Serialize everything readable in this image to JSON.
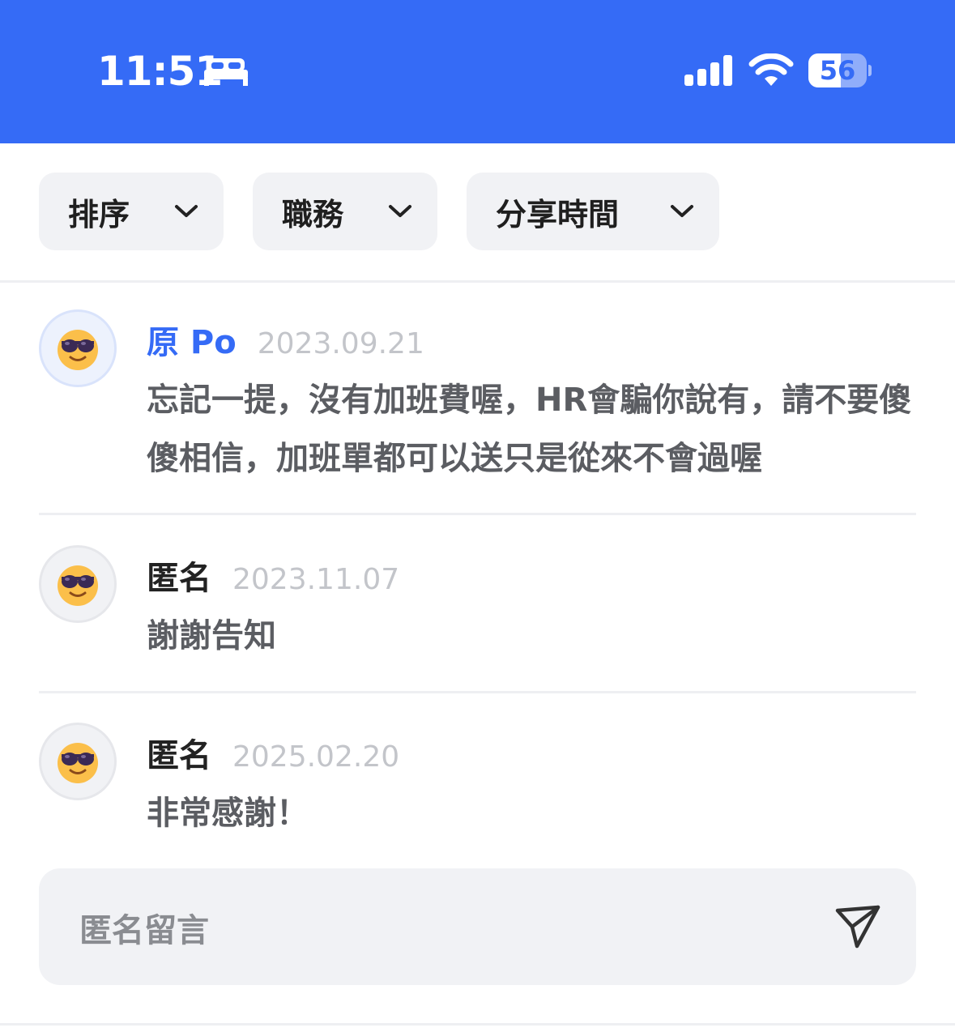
{
  "status": {
    "time": "11:51",
    "battery": "56",
    "battery_level": 0.56
  },
  "filters": [
    {
      "label": "排序"
    },
    {
      "label": "職務"
    },
    {
      "label": "分享時間"
    }
  ],
  "comments": [
    {
      "author": "原 Po",
      "is_op": true,
      "date": "2023.09.21",
      "text": "忘記一提，沒有加班費喔，HR會騙你說有，請不要傻傻相信，加班單都可以送只是從來不會過喔"
    },
    {
      "author": "匿名",
      "is_op": false,
      "date": "2023.11.07",
      "text": "謝謝告知"
    },
    {
      "author": "匿名",
      "is_op": false,
      "date": "2025.02.20",
      "text": "非常感謝！"
    }
  ],
  "input": {
    "placeholder": "匿名留言"
  },
  "icons": {
    "avatar": "sunglasses-face-icon",
    "send": "send-icon"
  },
  "colors": {
    "brand": "#356bf6",
    "chip_bg": "#f1f2f5",
    "date": "#c3c5ca"
  }
}
